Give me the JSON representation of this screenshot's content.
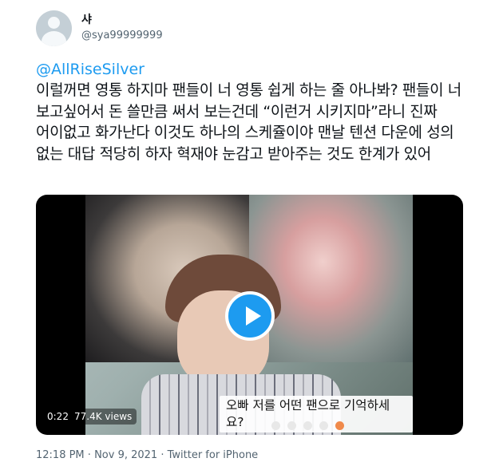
{
  "author": {
    "display_name": "샤",
    "handle": "@sya99999999"
  },
  "tweet": {
    "mention": "@AllRiseSilver",
    "text": "이럴꺼면 영통 하지마 팬들이 너 영통 쉽게 하는 줄 아나봐? 팬들이 너 보고싶어서 돈 쓸만큼 써서 보는건데 “이런거 시키지마”라니 진짜 어이없고 화가난다 이것도 하나의 스케쥴이야 맨날 텐션 다운에 성의 없는 대답 적당히 하자 혁재야 눈감고 받아주는 것도 한계가 있어"
  },
  "video": {
    "subtitle": "오빠 저를 어떤 팬으로 기억하세요?",
    "time": "0:22",
    "views": "77.4K views"
  },
  "meta": {
    "time": "12:18 PM",
    "separator1": " · ",
    "date": "Nov 9, 2021",
    "separator2": " · ",
    "source": "Twitter for iPhone"
  },
  "icons": {
    "avatar": "default-profile-icon",
    "play": "play-icon"
  },
  "colors": {
    "link": "#1d9bf0",
    "secondary_text": "#536471"
  }
}
